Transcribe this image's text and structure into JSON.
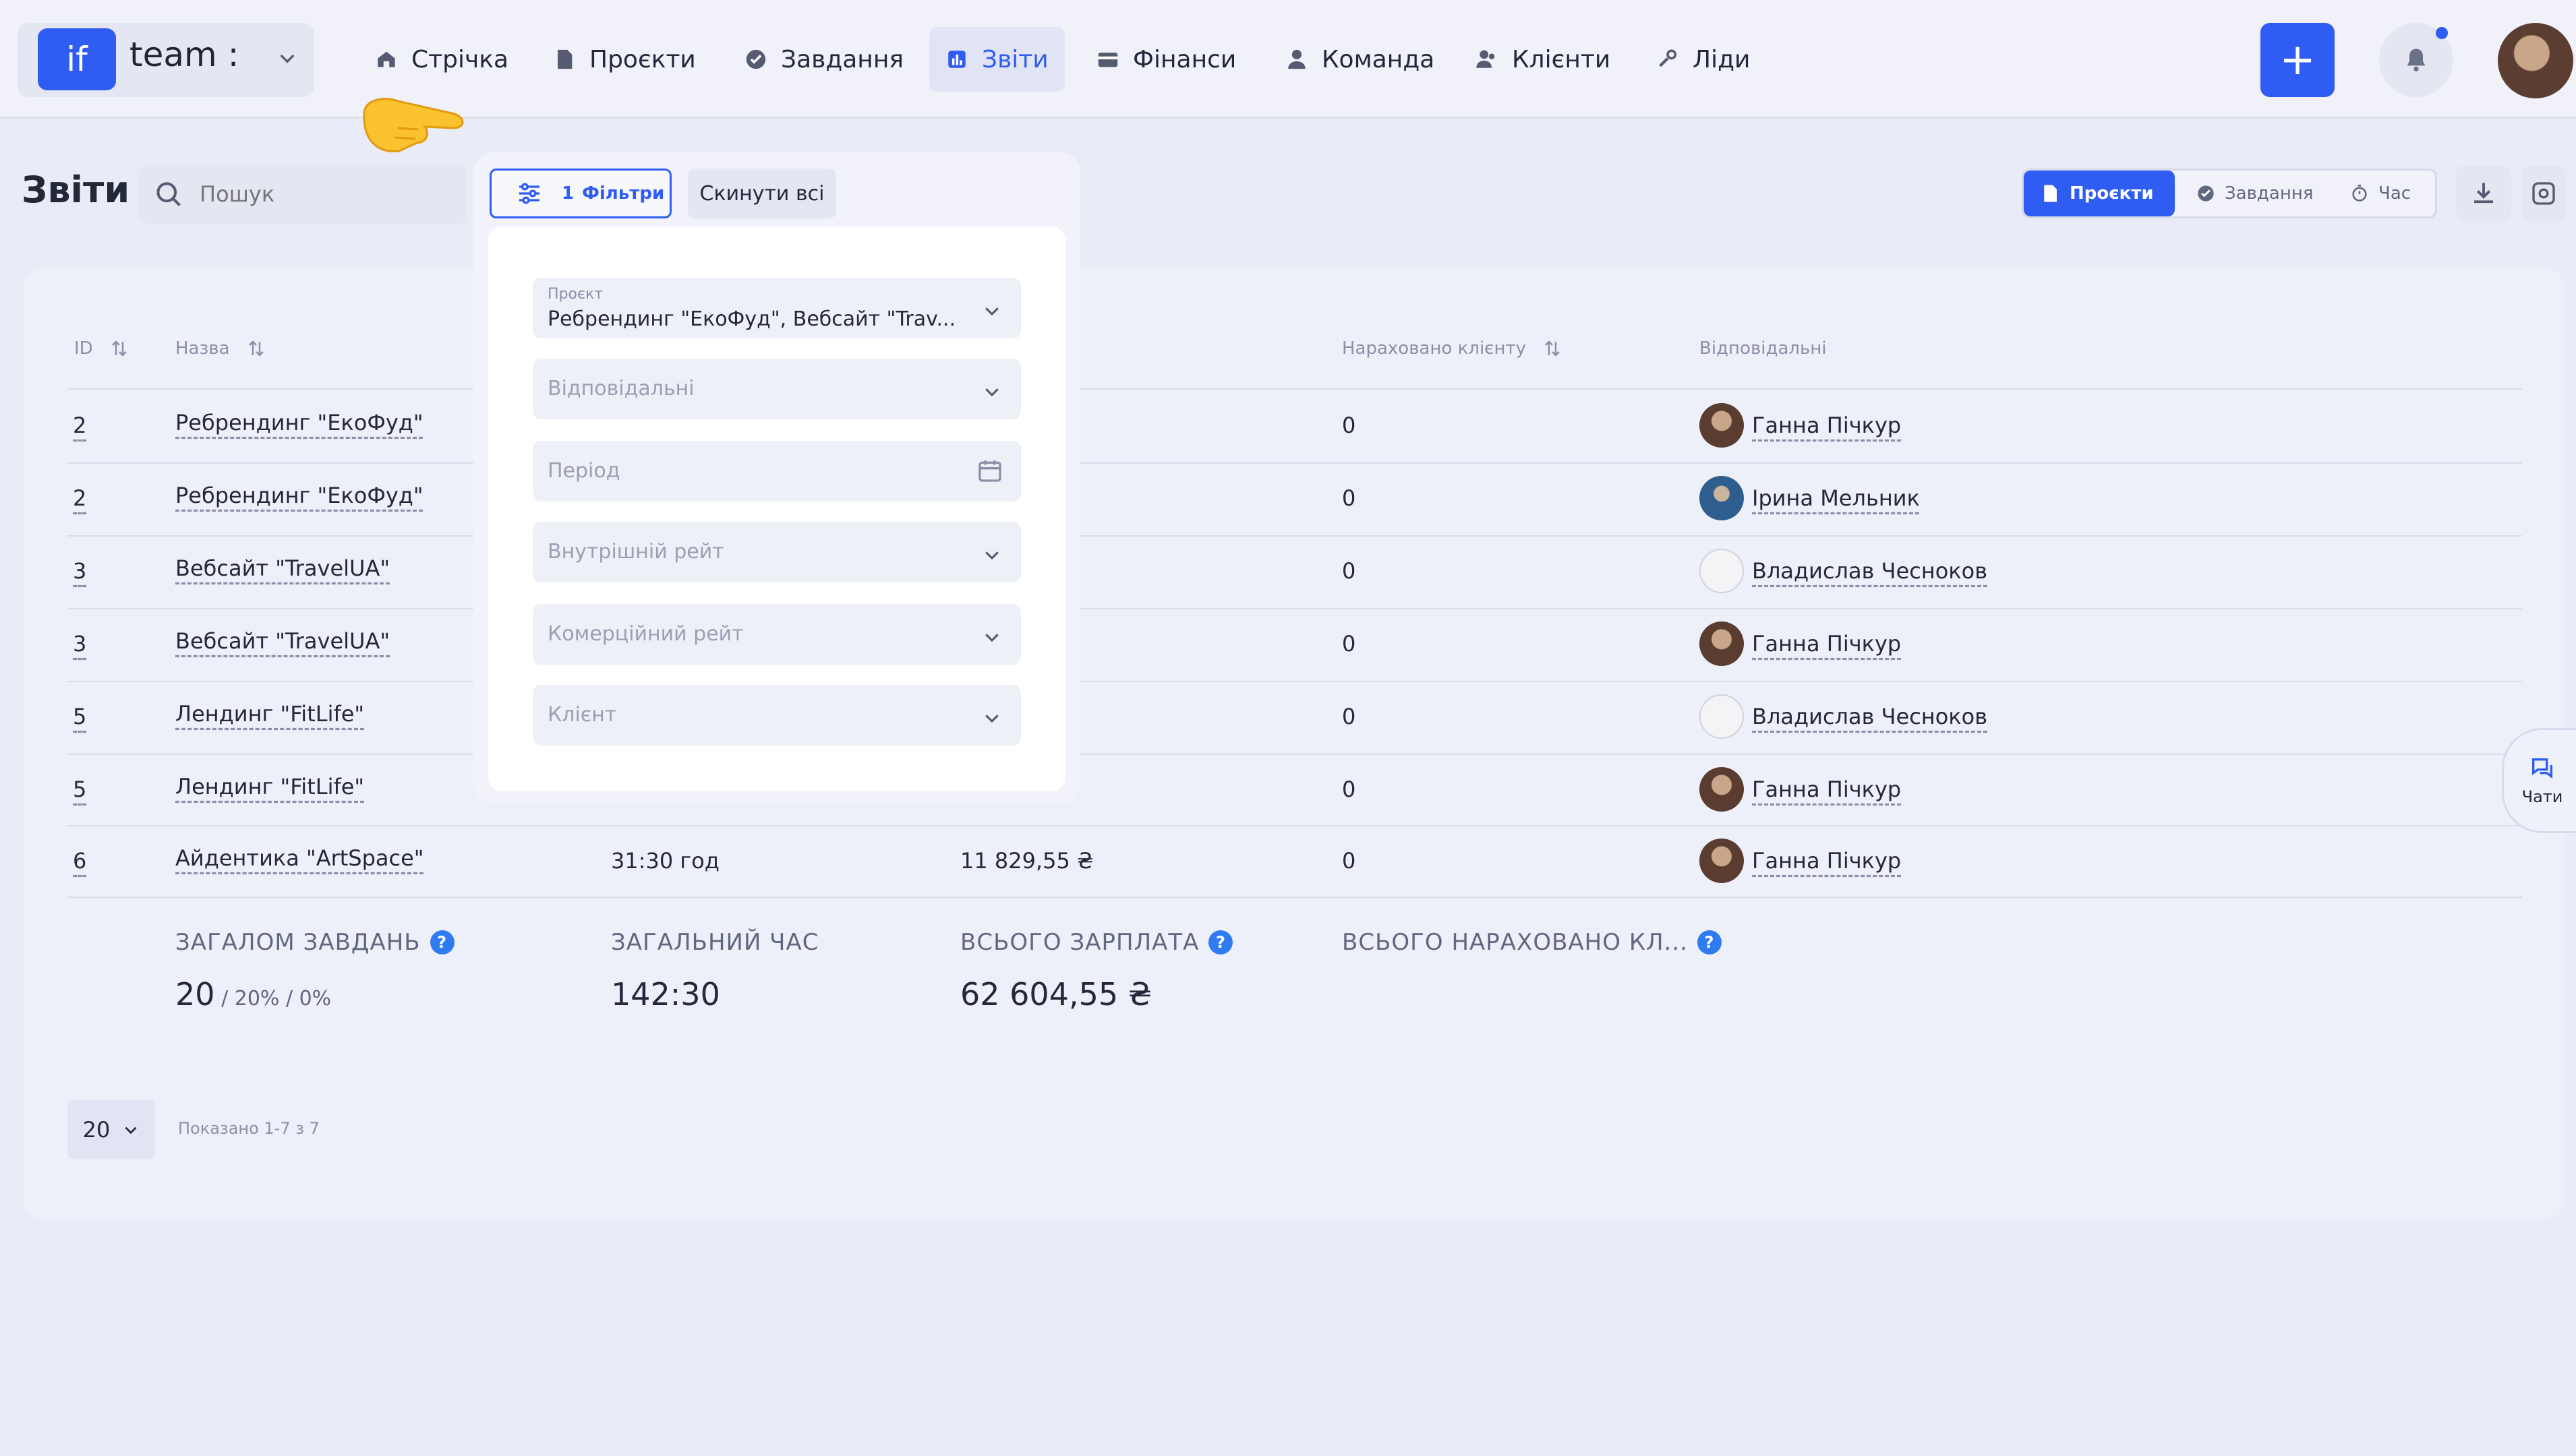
{
  "workspace": {
    "logo": "if",
    "name": "team :"
  },
  "nav": [
    {
      "label": "Стрічка",
      "icon": "home-icon"
    },
    {
      "label": "Проєкти",
      "icon": "document-icon"
    },
    {
      "label": "Завдання",
      "icon": "check-circle-icon"
    },
    {
      "label": "Звіти",
      "icon": "chart-icon",
      "active": true
    },
    {
      "label": "Фінанси",
      "icon": "wallet-icon"
    },
    {
      "label": "Команда",
      "icon": "user-icon"
    },
    {
      "label": "Клієнти",
      "icon": "users-icon"
    },
    {
      "label": "Ліди",
      "icon": "leads-icon"
    }
  ],
  "header": {
    "title": "Звіти",
    "search_placeholder": "Пошук",
    "filters_count": "1",
    "filters_label": "Фільтри",
    "reset_label": "Скинути всі",
    "segments": [
      "Проєкти",
      "Завдання",
      "Час"
    ]
  },
  "table": {
    "columns": [
      "ID",
      "Назва",
      "Нараховано клієнту",
      "Відповідальні"
    ],
    "rows": [
      {
        "id": "2",
        "name": "Ребрендинг \"ЕкоФуд\"",
        "hours": "",
        "salary": "",
        "charged": "0",
        "owner": "Ганна Пічкур"
      },
      {
        "id": "2",
        "name": "Ребрендинг \"ЕкоФуд\"",
        "hours": "",
        "salary": "",
        "charged": "0",
        "owner": "Ірина Мельник"
      },
      {
        "id": "3",
        "name": "Вебсайт \"TravelUA\"",
        "hours": "",
        "salary": "",
        "charged": "0",
        "owner": "Владислав Чесноков"
      },
      {
        "id": "3",
        "name": "Вебсайт \"TravelUA\"",
        "hours": "",
        "salary": "",
        "charged": "0",
        "owner": "Ганна Пічкур"
      },
      {
        "id": "5",
        "name": "Лендинг \"FitLife\"",
        "hours": "",
        "salary": "",
        "charged": "0",
        "owner": "Владислав Чесноков"
      },
      {
        "id": "5",
        "name": "Лендинг \"FitLife\"",
        "hours": "",
        "salary": "",
        "charged": "0",
        "owner": "Ганна Пічкур"
      },
      {
        "id": "6",
        "name": "Айдентика \"ArtSpace\"",
        "hours": "31:30 год",
        "salary": "11 829,55 ₴",
        "charged": "0",
        "owner": "Ганна Пічкур"
      }
    ]
  },
  "summary": {
    "tasks_label": "ЗАГАЛОМ ЗАВДАНЬ",
    "tasks_value": "20",
    "tasks_sub": " / 20% / 0%",
    "time_label": "ЗАГАЛЬНИЙ ЧАС",
    "time_value": "142:30",
    "salary_label": "ВСЬОГО ЗАРПЛАТА",
    "salary_value": "62 604,55 ₴",
    "charged_label": "ВСЬОГО НАРАХОВАНО КЛ..."
  },
  "pagination": {
    "per_page": "20",
    "shown": "Показано 1-7 з 7"
  },
  "filter_panel": {
    "project_label": "Проєкт",
    "project_value": "Ребрендинг \"ЕкоФуд\", Вебсайт \"Trav...",
    "responsible": "Відповідальні",
    "period": "Період",
    "internal_rate": "Внутрішній рейт",
    "commercial_rate": "Комерційний рейт",
    "client": "Клієнт"
  },
  "chats_label": "Чати",
  "colors": {
    "accent": "#2f5cf2",
    "bg": "#e9ebf7"
  }
}
